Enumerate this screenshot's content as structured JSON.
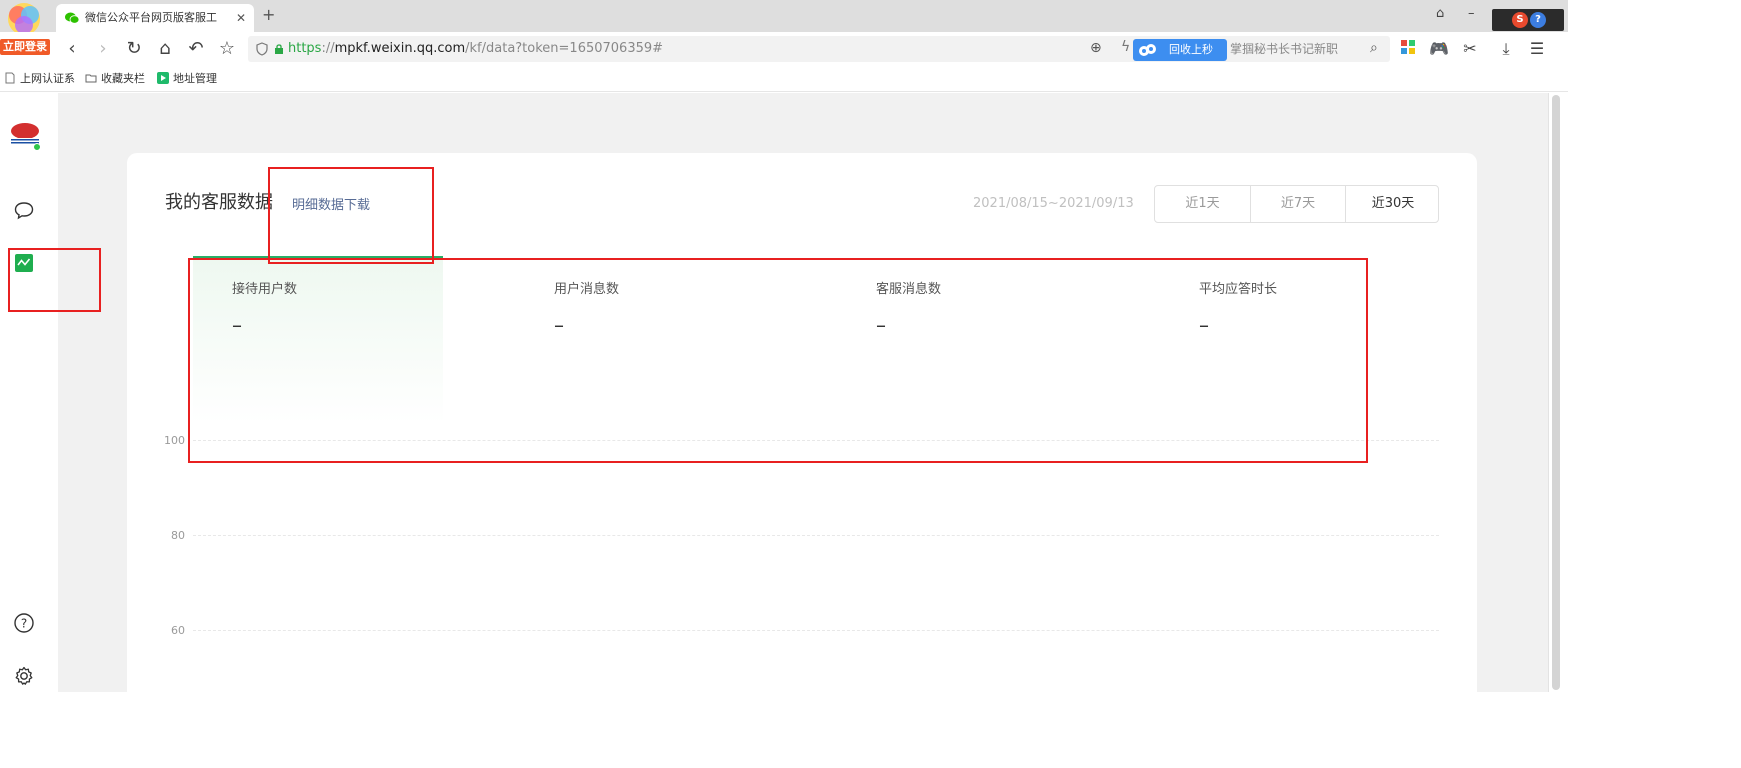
{
  "browser": {
    "login_badge": "立即登录",
    "tab_title": "微信公众平台网页版客服工",
    "tab_close": "✕",
    "new_tab": "+",
    "url_https": "https",
    "url_sep": "://",
    "url_host": "mpkf.weixin.qq.com",
    "url_path": "/kf/data?token=1650706359#",
    "promo_label": "回收上秒",
    "news_text": "掌掴秘书长书记新职",
    "window_controls": [
      "⌂",
      "–"
    ],
    "bookmarks": [
      "上网认证系",
      "收藏夹栏",
      "地址管理"
    ]
  },
  "page": {
    "title": "我的客服数据",
    "download_link": "明细数据下载",
    "date_range": "2021/08/15~2021/09/13",
    "ranges": [
      {
        "label": "近1天",
        "active": false
      },
      {
        "label": "近7天",
        "active": false
      },
      {
        "label": "近30天",
        "active": true
      }
    ],
    "stats": [
      {
        "label": "接待用户数",
        "value": "–"
      },
      {
        "label": "用户消息数",
        "value": "–"
      },
      {
        "label": "客服消息数",
        "value": "–"
      },
      {
        "label": "平均应答时长",
        "value": "–"
      }
    ]
  },
  "chart_data": {
    "type": "line",
    "yticks": [
      100,
      80,
      60
    ],
    "series": []
  },
  "colors": {
    "accent": "#2aae67",
    "annotation": "#e82020",
    "link": "#576b95"
  }
}
